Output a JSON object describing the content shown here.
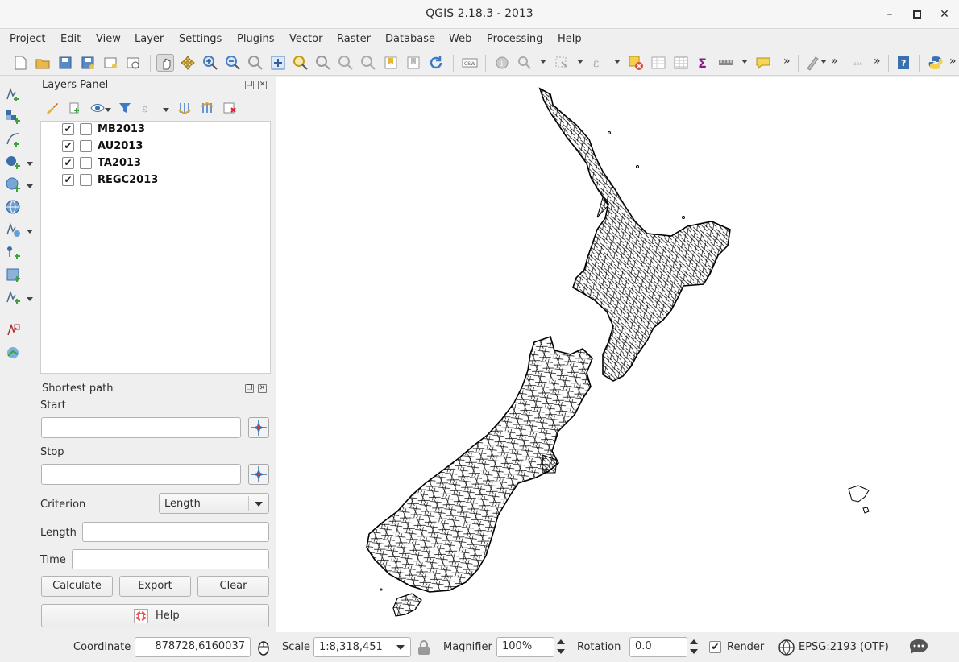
{
  "window": {
    "title": "QGIS 2.18.3 - 2013"
  },
  "menu": [
    "Project",
    "Edit",
    "View",
    "Layer",
    "Settings",
    "Plugins",
    "Vector",
    "Raster",
    "Database",
    "Web",
    "Processing",
    "Help"
  ],
  "layers_panel": {
    "title": "Layers Panel",
    "layers": [
      {
        "name": "MB2013",
        "visible": true
      },
      {
        "name": "AU2013",
        "visible": true
      },
      {
        "name": "TA2013",
        "visible": true
      },
      {
        "name": "REGC2013",
        "visible": true
      }
    ]
  },
  "shortest_path": {
    "title": "Shortest path",
    "start_label": "Start",
    "start_value": "",
    "stop_label": "Stop",
    "stop_value": "",
    "criterion_label": "Criterion",
    "criterion_value": "Length",
    "length_label": "Length",
    "length_value": "",
    "time_label": "Time",
    "time_value": "",
    "calculate": "Calculate",
    "export": "Export",
    "clear": "Clear",
    "help": "Help"
  },
  "status": {
    "coordinate_label": "Coordinate",
    "coordinate_value": "878728,6160037",
    "scale_label": "Scale",
    "scale_value": "1:8,318,451",
    "magnifier_label": "Magnifier",
    "magnifier_value": "100%",
    "rotation_label": "Rotation",
    "rotation_value": "0.0",
    "render_label": "Render",
    "render_checked": true,
    "crs": "EPSG:2193 (OTF)"
  },
  "toolbar_overflow": "»",
  "colors": {
    "accent": "#4a7fbf",
    "map_stroke": "#000000"
  }
}
